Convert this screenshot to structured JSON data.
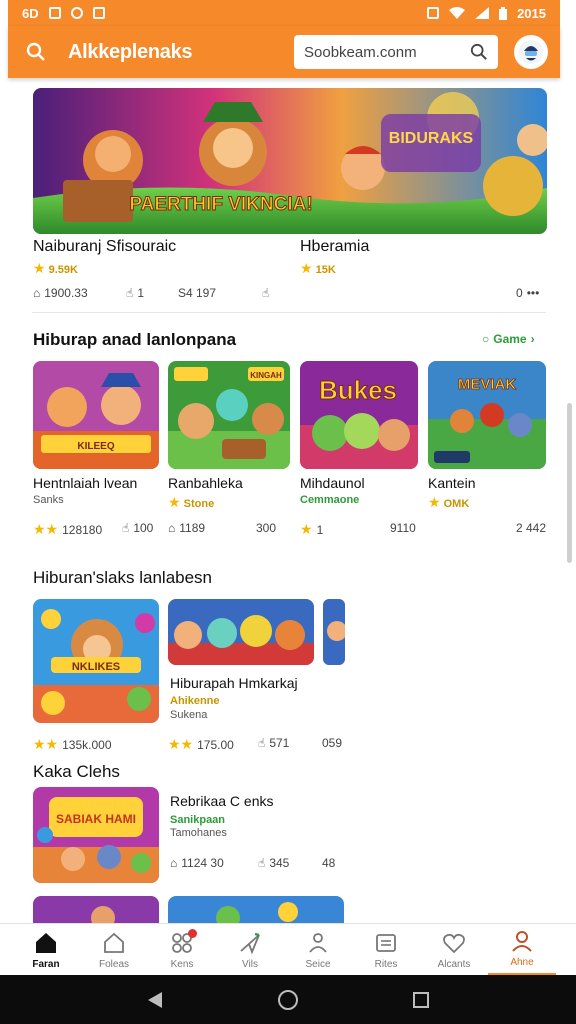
{
  "status_bar": {
    "left_text": "6D",
    "time": "2015"
  },
  "app_bar": {
    "title": "Alkkeplenaks",
    "search_text": "Soobkeam.conm"
  },
  "featured": {
    "banner_text": "PAERTHIF VIKNCIA!",
    "banner_badge": "BIDURAKS",
    "items": [
      {
        "title": "Naiburanj Sfisouraic",
        "sub": "9.59K"
      },
      {
        "title": "Hberamia",
        "sub": "15K"
      }
    ],
    "stats": [
      "1900.33",
      "1",
      "S4 197"
    ],
    "more": "0"
  },
  "section1": {
    "title": "Hiburap anad lanlonpana",
    "link": "Game",
    "cards": [
      {
        "title": "Hentnlaiah lvean",
        "sub": "Sanks",
        "stat1": "128180",
        "stat2": "100",
        "art_text": "KILEEQ"
      },
      {
        "title": "Ranbahleka",
        "sub": "Stone",
        "stat1": "1189",
        "stat2": "300",
        "art_text": "KINGAH"
      },
      {
        "title": "Mihdaunol",
        "sub": "Cemmaone",
        "stat1": "1",
        "stat2": "9110",
        "art_text": "Bukes"
      },
      {
        "title": "Kantein",
        "sub": "OMK",
        "stat1": "",
        "stat2": "2 442",
        "art_text": "MEVIAK"
      }
    ]
  },
  "section2": {
    "title": "Hiburan'slaks lanlabesn",
    "card_main": {
      "art_text": "NKLIKES",
      "stat": "135k.000"
    },
    "card_wide": {
      "title": "Hiburapah Hmkarkaj",
      "sub1": "Ahikenne",
      "sub2": "Sukena",
      "stat1": "175.00",
      "stat2": "571",
      "stat3": "059"
    }
  },
  "section3": {
    "title": "Kaka Clehs",
    "card": {
      "art_text": "SABIAK HAMI",
      "title": "Rebrikaa C enks",
      "sub1": "Sanikpaan",
      "sub2": "Tamohanes",
      "stat1": "1124 30",
      "stat2": "345",
      "stat3": "48"
    }
  },
  "bottom_nav": [
    {
      "label": "Faran",
      "icon": "home-icon"
    },
    {
      "label": "Foleas",
      "icon": "house-outline-icon"
    },
    {
      "label": "Kens",
      "icon": "grid-icon"
    },
    {
      "label": "Vils",
      "icon": "send-icon"
    },
    {
      "label": "Seice",
      "icon": "people-icon"
    },
    {
      "label": "Rites",
      "icon": "list-icon"
    },
    {
      "label": "Alcants",
      "icon": "heart-icon"
    },
    {
      "label": "Ahne",
      "icon": "profile-icon"
    }
  ],
  "colors": {
    "accent": "#f6892a",
    "green": "#2e9b3b",
    "gold": "#f5b800"
  }
}
